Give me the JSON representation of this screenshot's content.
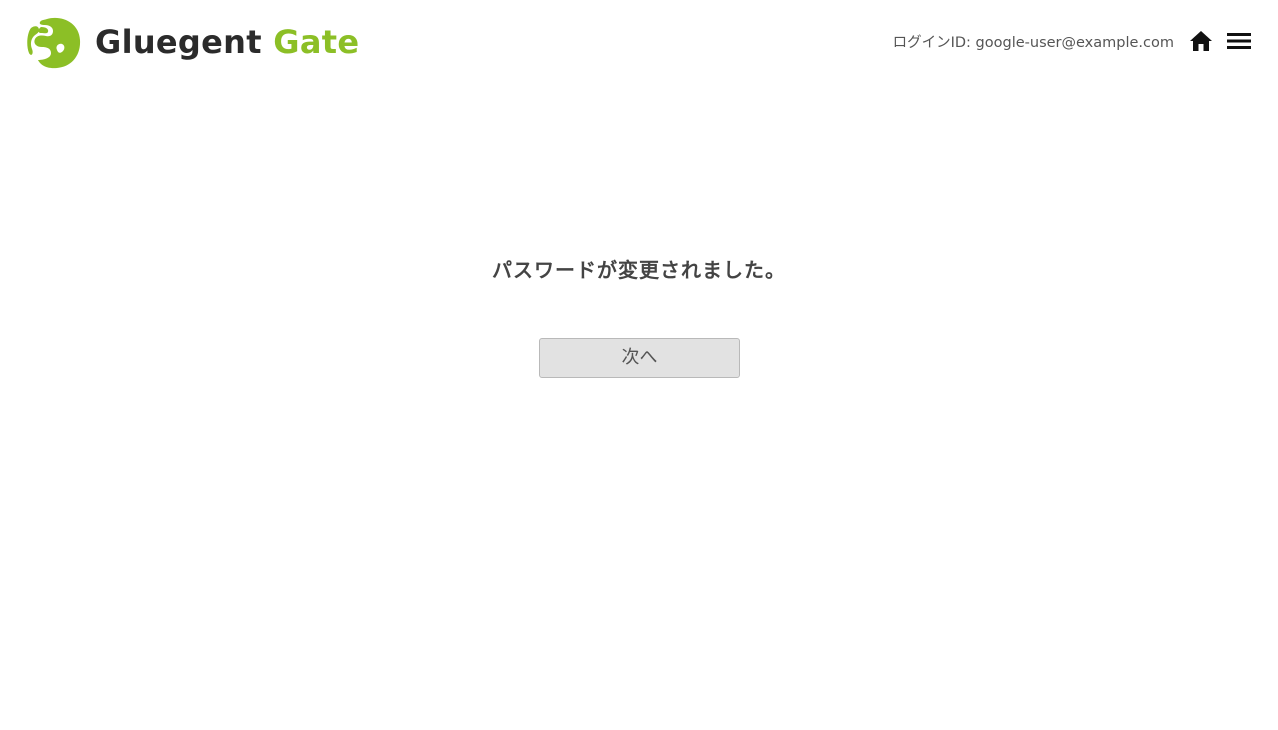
{
  "header": {
    "logo": {
      "word_1": "Gluegent",
      "word_2": "Gate",
      "brand_color": "#8cbf26",
      "text_color": "#2b2b2b"
    },
    "login_label": "ログインID: google-user@example.com",
    "home_icon": "home-icon",
    "menu_icon": "hamburger-menu-icon"
  },
  "main": {
    "message": "パスワードが変更されました。",
    "next_button_label": "次へ"
  }
}
